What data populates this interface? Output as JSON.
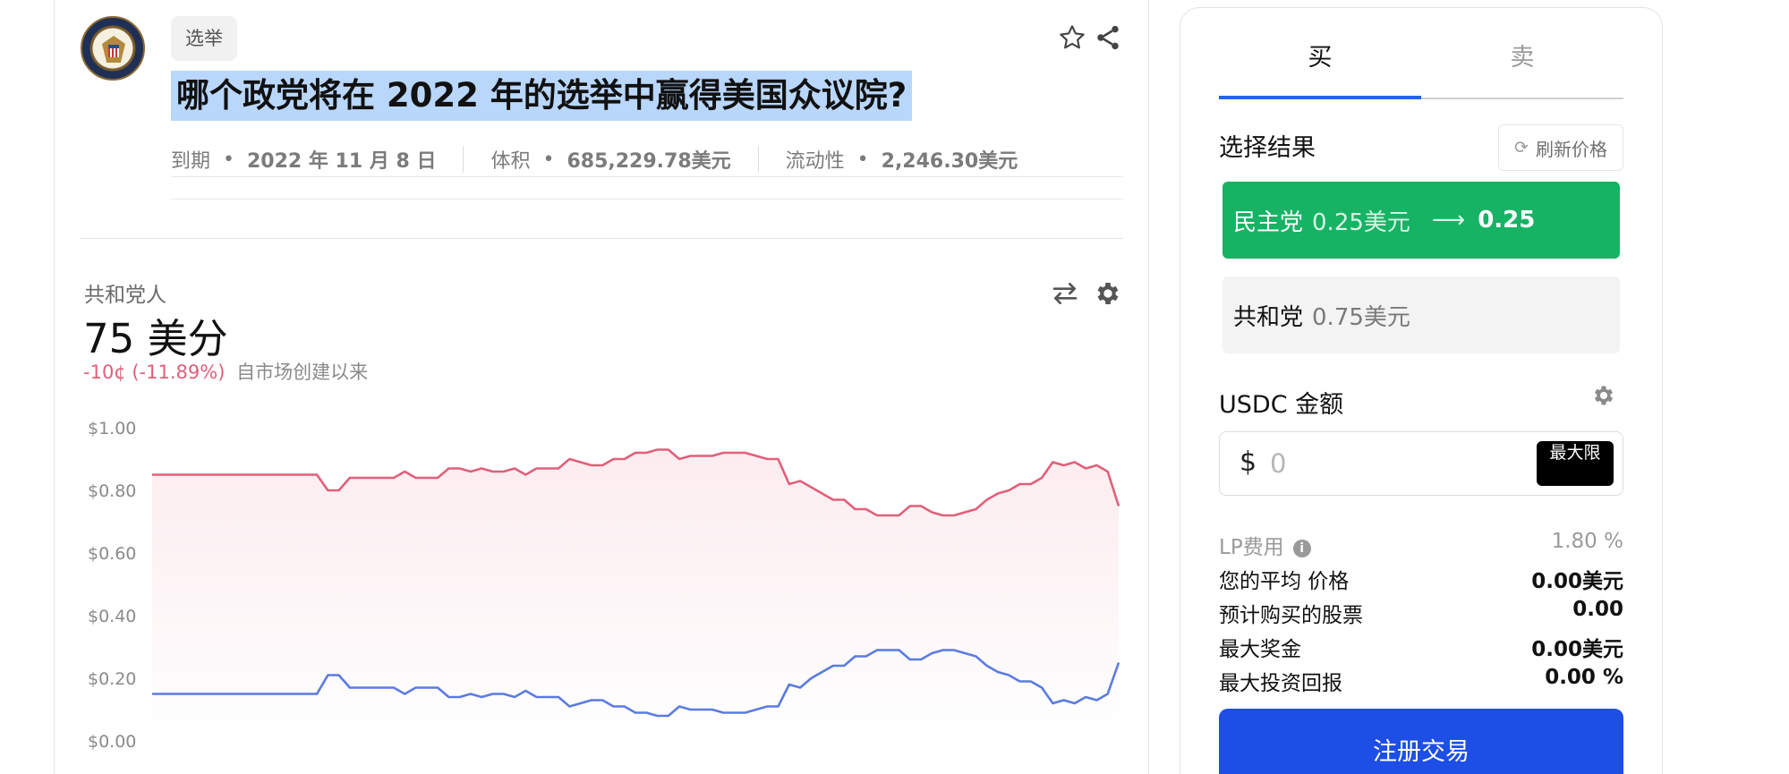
{
  "market": {
    "tag": "选举",
    "title": "哪个政党将在 2022 年的选举中赢得美国众议院?",
    "meta": {
      "expiry_label": "到期",
      "expiry_value": "2022 年 11 月 8 日",
      "volume_label": "体积",
      "volume_value": "685,229.78美元",
      "liquidity_label": "流动性",
      "liquidity_value": "2,246.30美元"
    }
  },
  "price_panel": {
    "series_label": "共和党人",
    "price": "75 美分",
    "change_abs": "-10¢",
    "change_pct": "(-11.89%)",
    "change_since": "自市场创建以来"
  },
  "colors": {
    "accent": "#2563eb",
    "republican": "#e0607b",
    "democrat": "#5b7be0",
    "green": "#16b364",
    "signup": "#1d4ee6"
  },
  "chart_data": {
    "type": "line",
    "ylim": [
      0,
      1
    ],
    "yticks": [
      "$1.00",
      "$0.80",
      "$0.60",
      "$0.40",
      "$0.20",
      "$0.00"
    ],
    "yvalues": [
      1.0,
      0.8,
      0.6,
      0.4,
      0.2,
      0.0
    ],
    "grid": false,
    "series": [
      {
        "color": "#e0607b",
        "values": [
          0.85,
          0.85,
          0.85,
          0.85,
          0.85,
          0.85,
          0.85,
          0.85,
          0.85,
          0.85,
          0.85,
          0.85,
          0.85,
          0.85,
          0.85,
          0.85,
          0.8,
          0.8,
          0.84,
          0.84,
          0.84,
          0.84,
          0.84,
          0.86,
          0.84,
          0.84,
          0.84,
          0.87,
          0.87,
          0.86,
          0.87,
          0.86,
          0.86,
          0.87,
          0.85,
          0.87,
          0.87,
          0.87,
          0.9,
          0.89,
          0.88,
          0.88,
          0.9,
          0.9,
          0.92,
          0.92,
          0.93,
          0.93,
          0.9,
          0.91,
          0.91,
          0.91,
          0.92,
          0.92,
          0.92,
          0.91,
          0.9,
          0.9,
          0.82,
          0.83,
          0.81,
          0.79,
          0.77,
          0.77,
          0.74,
          0.74,
          0.72,
          0.72,
          0.72,
          0.75,
          0.75,
          0.73,
          0.72,
          0.72,
          0.73,
          0.74,
          0.77,
          0.79,
          0.8,
          0.82,
          0.82,
          0.84,
          0.89,
          0.88,
          0.89,
          0.87,
          0.88,
          0.86,
          0.75
        ]
      },
      {
        "color": "#5b7be0",
        "values": [
          0.15,
          0.15,
          0.15,
          0.15,
          0.15,
          0.15,
          0.15,
          0.15,
          0.15,
          0.15,
          0.15,
          0.15,
          0.15,
          0.15,
          0.15,
          0.15,
          0.21,
          0.21,
          0.17,
          0.17,
          0.17,
          0.17,
          0.17,
          0.15,
          0.17,
          0.17,
          0.17,
          0.14,
          0.14,
          0.15,
          0.14,
          0.15,
          0.15,
          0.14,
          0.16,
          0.14,
          0.14,
          0.14,
          0.11,
          0.12,
          0.13,
          0.13,
          0.11,
          0.11,
          0.09,
          0.09,
          0.08,
          0.08,
          0.11,
          0.1,
          0.1,
          0.1,
          0.09,
          0.09,
          0.09,
          0.1,
          0.11,
          0.11,
          0.18,
          0.17,
          0.2,
          0.22,
          0.24,
          0.24,
          0.27,
          0.27,
          0.29,
          0.29,
          0.29,
          0.26,
          0.26,
          0.28,
          0.29,
          0.29,
          0.28,
          0.27,
          0.24,
          0.22,
          0.21,
          0.19,
          0.19,
          0.17,
          0.12,
          0.13,
          0.12,
          0.14,
          0.13,
          0.15,
          0.25
        ]
      }
    ]
  },
  "trade": {
    "tab_buy": "买",
    "tab_sell": "卖",
    "select_title": "选择结果",
    "refresh_label": "刷新价格",
    "outcome_dem_name": "民主党",
    "outcome_dem_price": "0.25美元",
    "outcome_dem_after": "0.25",
    "outcome_rep_name": "共和党",
    "outcome_rep_price": "0.75美元",
    "amount_title": "USDC 金额",
    "amount_currency": "$",
    "amount_placeholder": "0",
    "max_label": "最大限",
    "stats": {
      "lp_label": "LP费用",
      "lp_value": "1.80 %",
      "avg_price_label": "您的平均 价格",
      "avg_price_value": "0.00美元",
      "shares_label": "预计购买的股票",
      "shares_value": "0.00",
      "max_payout_label": "最大奖金",
      "max_payout_value": "0.00美元",
      "max_roi_label": "最大投资回报",
      "max_roi_value": "0.00 %"
    },
    "signup_label": "注册交易"
  }
}
